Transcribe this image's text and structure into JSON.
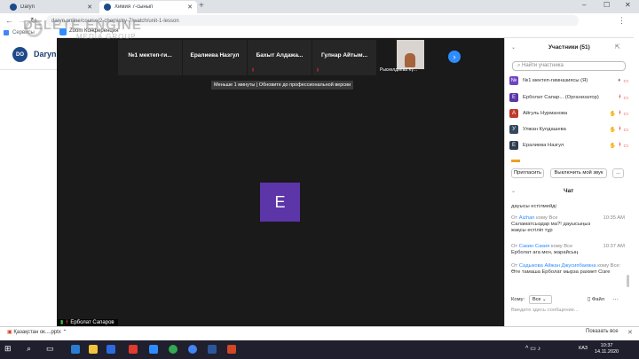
{
  "browser": {
    "tabs": [
      {
        "title": "Daryn",
        "favicon_color": "#1e4a8a"
      },
      {
        "title": "Химия 7-сынып",
        "favicon_color": "#1e4a8a"
      }
    ],
    "address": "daryn.online/course/2-chemistry-7/watch/unit-1-lesson",
    "bookmark": "Сервисы",
    "window_controls": {
      "minimize": "–",
      "maximize": "☐",
      "close": "✕"
    }
  },
  "watermark": {
    "title": "DELETE ENGINE",
    "subtitle": "MEDIA GROUP"
  },
  "site": {
    "logo": "DO",
    "name": "Daryn"
  },
  "zoom": {
    "title": "Zoom Конференция",
    "participants_strip": [
      {
        "name": "№1 мектеп-ги...",
        "muted": false
      },
      {
        "name": "Ералиева Назгул",
        "muted": false
      },
      {
        "name": "Бахыт Алдажа...",
        "muted": true
      },
      {
        "name": "Гулнар Айтым...",
        "muted": true
      }
    ],
    "camera_tile_name": "Рыскелдиева Кү...",
    "trial_notice": "Меньше 1 минуты | Обновите до профессиональной версии",
    "active_avatar_letter": "E",
    "active_avatar_color": "#5c35a8",
    "active_speaker": "Ерболат Сапаров"
  },
  "panel": {
    "participants_title": "Участники (51)",
    "search_placeholder": "Найти участника",
    "participants": [
      {
        "initial": "№",
        "name": "№1 мектеп-гимназиясы (Я)",
        "color": "#6e45c4"
      },
      {
        "initial": "E",
        "name": "Ерболат Сапар...  (Организатор)",
        "color": "#5c35a8"
      },
      {
        "initial": "А",
        "name": "Айгуль Нурманова",
        "color": "#c0392b"
      },
      {
        "initial": "У",
        "name": "Улжан Кулдашева",
        "color": "#34495e"
      },
      {
        "initial": "E",
        "name": "Ералиева Назгул",
        "color": "#2c3e50"
      }
    ],
    "invite_label": "Пригласить",
    "mute_label": "Выключить мой звук",
    "more_label": "...",
    "chat_title": "Чат",
    "chat_messages": [
      {
        "meta": "",
        "who": "",
        "time": "",
        "text": "дауысы естілмейді"
      },
      {
        "meta": "От",
        "who": "Aizhan",
        "to": "кому Все",
        "time": "10:35 AM",
        "text": "Саламатсыздар ма?! дауысыңыз жақсы естіліп тұр"
      },
      {
        "meta": "От",
        "who": "Сакин Сакия",
        "to": "кому Все",
        "time": "10:37 AM",
        "text": "Ерболат аға мен, жарайсың"
      },
      {
        "meta": "От",
        "who": "Садыкова Айжан Джусипбаевна",
        "to": "кому Все:",
        "time": "",
        "text": "Өте тамаша Ерболат мырза рахмет Сізге"
      }
    ],
    "to_label": "Кому:",
    "to_value": "Все",
    "file_label": "Файл",
    "input_placeholder": "Введите здесь сообщение..."
  },
  "downloads": {
    "file": "Қазақстан ок....pptx",
    "show_all": "Показать все"
  },
  "taskbar": {
    "lang": "КАЗ",
    "time": "10:37",
    "date": "14.11.2020"
  }
}
